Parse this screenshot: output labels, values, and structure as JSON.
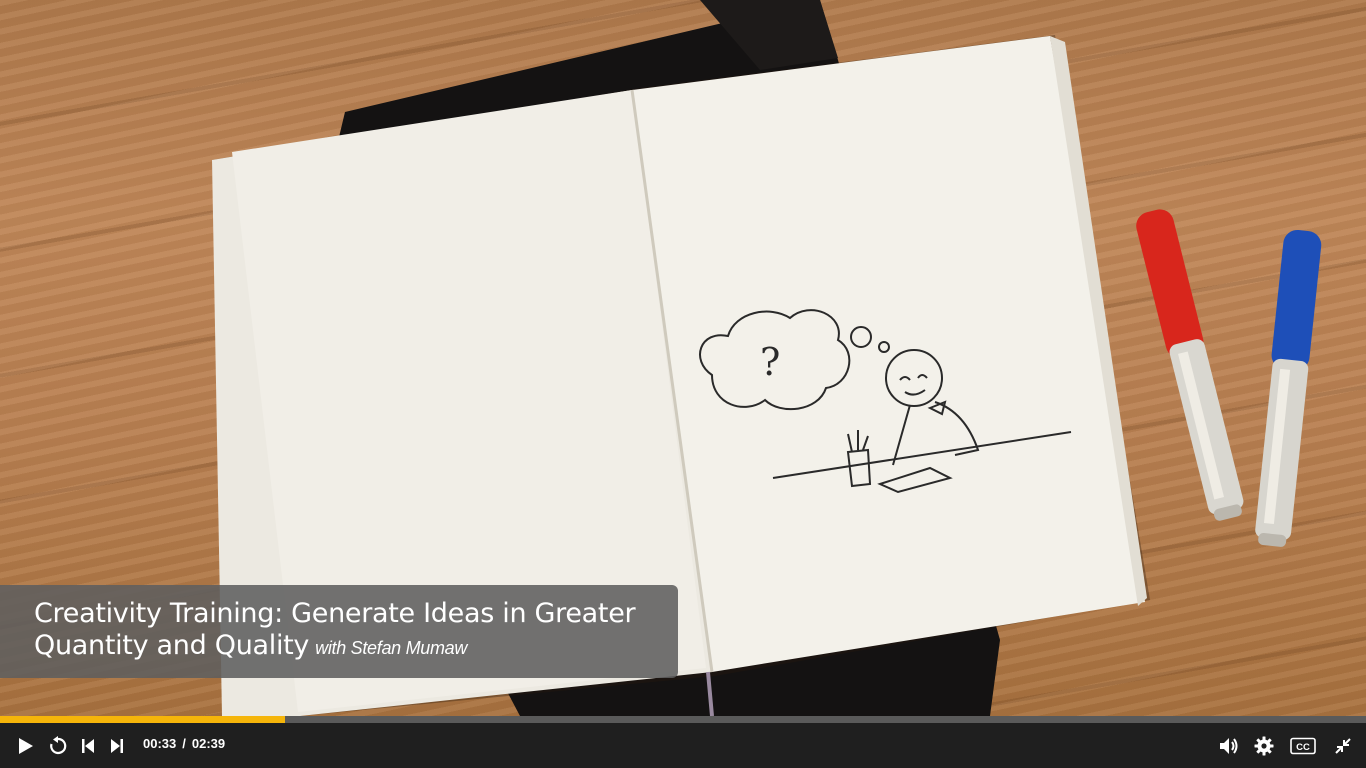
{
  "video": {
    "title": "Creativity Training: Generate Ideas in Greater Quantity and Quality",
    "author": "with Stefan Mumaw",
    "frame_sketch_text": "?"
  },
  "playback": {
    "current_time": "00:33",
    "separator": "/",
    "duration": "02:39",
    "progress_fraction": 0.209
  },
  "controls": {
    "left": [
      "play-icon",
      "replay-icon",
      "previous-icon",
      "next-icon"
    ],
    "right": [
      "volume-icon",
      "settings-icon",
      "captions-icon",
      "exit-fullscreen-icon"
    ],
    "captions_label": "CC"
  },
  "colors": {
    "progress_fill": "#f5b50a",
    "progress_track": "#5a5a5a",
    "control_bar": "#1f1f1f",
    "icon": "#ffffff"
  }
}
